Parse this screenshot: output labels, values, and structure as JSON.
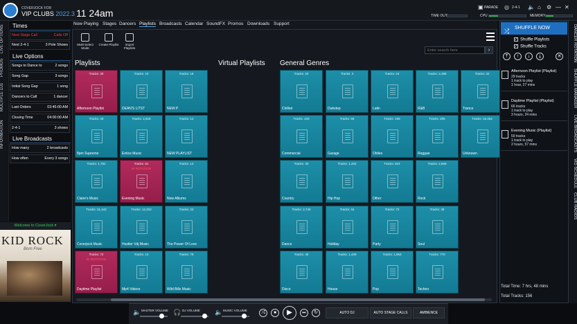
{
  "header": {
    "brand_small": "COVERJOCK FOR",
    "brand_big": "VIP CLUBS",
    "brand_year": "2022.3",
    "clock": "11 24am",
    "parade_label": "PARADE",
    "counter_label": "2-4-1",
    "timeout_label": "TIME OUT",
    "cpu_label": "CPU",
    "memory_label": "MEMORY",
    "timeout_fill": 0.0,
    "cpu_fill": 0.25,
    "memory_fill": 0.3
  },
  "left": {
    "vtabs": [
      "LIVE OPTIONS",
      "PROMOS",
      "MULTIPLE DJs",
      "INFORMATION"
    ],
    "times_title": "Times",
    "times": [
      {
        "k": "Next Stage Call",
        "v": "Calls Off",
        "red": true
      },
      {
        "k": "Next 2-4-1",
        "v": "3 Pole Shows",
        "red": false
      }
    ],
    "live_title": "Live Options",
    "live": [
      {
        "k": "Songs to Dance to",
        "v": "2 songs"
      },
      {
        "k": "Song Gap",
        "v": "3 songs"
      },
      {
        "k": "Initial Song Gap",
        "v": "1 song"
      },
      {
        "k": "Dancers to Call",
        "v": "1 dancer"
      },
      {
        "k": "Last Orders",
        "v": "03:45:00 AM"
      },
      {
        "k": "Closing Time",
        "v": "04:00:00 AM"
      },
      {
        "k": "2-4-1",
        "v": "3 shows"
      }
    ],
    "broadcast_title": "Live Broadcasts",
    "broadcasts": [
      {
        "k": "How many",
        "v": "2 broadcasts"
      },
      {
        "k": "How often",
        "v": "Every 3 songs"
      }
    ],
    "welcome": "Welcome to CoverJock",
    "album_title": "KID ROCK",
    "album_sub": "Born Free"
  },
  "nav": [
    "Now Playing",
    "Stages",
    "Dancers",
    "Playlists",
    "Broadcasts",
    "Calendar",
    "SoundFX",
    "Promos",
    "Downloads",
    "Support"
  ],
  "toolbar": {
    "multi_select": "Multi-Select Mode",
    "create": "Create Playlist",
    "import": "Import Playlists",
    "search_placeholder": "Enter search here"
  },
  "headings": {
    "playlists": "Playlists",
    "virtual": "Virtual Playlists",
    "genres": "General Genres"
  },
  "playlists": [
    {
      "name": "Afternoon Playlist",
      "tracks": "Tracks: 30",
      "red": true
    },
    {
      "name": "DEAN'S LITST",
      "tracks": "Tracks: 10"
    },
    {
      "name": "NEW P",
      "tracks": "Tracks: 18"
    },
    {
      "name": "8pm Supreme",
      "tracks": "Tracks: 40"
    },
    {
      "name": "Entice Music",
      "tracks": "Tracks: 2,818"
    },
    {
      "name": "NEW PLAYLIST",
      "tracks": "Tracks: 12"
    },
    {
      "name": "Claire's Music",
      "tracks": "Tracks: 1,781"
    },
    {
      "name": "Evening Music",
      "tracks": "Tracks: 61",
      "red": true,
      "badge": "IN ROTATION"
    },
    {
      "name": "Now Albums",
      "tracks": "Tracks: 12"
    },
    {
      "name": "Coverjock Music",
      "tracks": "Tracks: 21,442"
    },
    {
      "name": "Hustler Vdj Music",
      "tracks": "Tracks: 12,202"
    },
    {
      "name": "The Power Of Love",
      "tracks": "Tracks: 22"
    },
    {
      "name": "Daytime Playlist",
      "tracks": "Tracks: 72",
      "red": true,
      "badge": "IN ROTATION"
    },
    {
      "name": "Mp4 Videos",
      "tracks": "Tracks: 13"
    },
    {
      "name": "Wild Bills Music",
      "tracks": "Tracks: 79"
    }
  ],
  "genres": [
    {
      "name": "Chilled",
      "tracks": "Tracks: 20"
    },
    {
      "name": "Dubstep",
      "tracks": "Tracks: 3"
    },
    {
      "name": "Latin",
      "tracks": "Tracks: 24"
    },
    {
      "name": "R&B",
      "tracks": "Tracks: 2,398"
    },
    {
      "name": "Trance",
      "tracks": "Tracks: 32"
    },
    {
      "name": "Commercial",
      "tracks": "Tracks: 433"
    },
    {
      "name": "Garage",
      "tracks": "Tracks: 58"
    },
    {
      "name": "Oldies",
      "tracks": "Tracks: 106"
    },
    {
      "name": "Reggae",
      "tracks": "Tracks: 205"
    },
    {
      "name": "Unknown",
      "tracks": "Tracks: 15,454"
    },
    {
      "name": "Country",
      "tracks": "Tracks: 40"
    },
    {
      "name": "Hip Hop",
      "tracks": "Tracks: 1,252"
    },
    {
      "name": "Other",
      "tracks": "Tracks: 824"
    },
    {
      "name": "Rock",
      "tracks": "Tracks: 2,659"
    },
    {
      "name": "Dance",
      "tracks": "Tracks: 2,740"
    },
    {
      "name": "Holiday",
      "tracks": "Tracks: 44"
    },
    {
      "name": "Party",
      "tracks": "Tracks: 72"
    },
    {
      "name": "Soul",
      "tracks": "Tracks: 38"
    },
    {
      "name": "Disco",
      "tracks": "Tracks: 48"
    },
    {
      "name": "House",
      "tracks": "Tracks: 1,409"
    },
    {
      "name": "Pop",
      "tracks": "Tracks: 1,953"
    },
    {
      "name": "Techno",
      "tracks": "Tracks: 770"
    }
  ],
  "right": {
    "shuffle_now": "SHUFFLE NOW",
    "shuffle_playlists": "Shuffle Playlists",
    "shuffle_tracks": "Shuffle Tracks",
    "items": [
      {
        "title": "Afternoon Playlist (Playlist)",
        "tracks": "29 tracks",
        "play": "1 track to play",
        "time": "1 hour, 27 mins"
      },
      {
        "title": "Daytime Playlist (Playlist)",
        "tracks": "66 tracks",
        "play": "1 track to play",
        "time": "3 hours, 24 mins"
      },
      {
        "title": "Evening Music (Playlist)",
        "tracks": "59 tracks",
        "play": "1 track to play",
        "time": "2 hours, 57 mins"
      }
    ],
    "total_time": "Total Time: 7 hrs, 48 mins",
    "total_tracks": "Total Tracks: 156",
    "vtabs": [
      "DANCER ROTATION",
      "SHUFFLE MANAGER",
      "LIVE BROADCASTS",
      "VID SCHEDULE",
      "CLUB RADIOS"
    ]
  },
  "bottom": {
    "master": "MASTER VOLUME",
    "dj": "DJ VOLUME",
    "music": "MUSIC VOLUME",
    "master_level": 0.78,
    "dj_level": 0.85,
    "music_level": 0.8,
    "auto_dj": "AUTO DJ",
    "auto_stage": "AUTO STAGE CALLS",
    "ambience": "AMBIENCE"
  }
}
